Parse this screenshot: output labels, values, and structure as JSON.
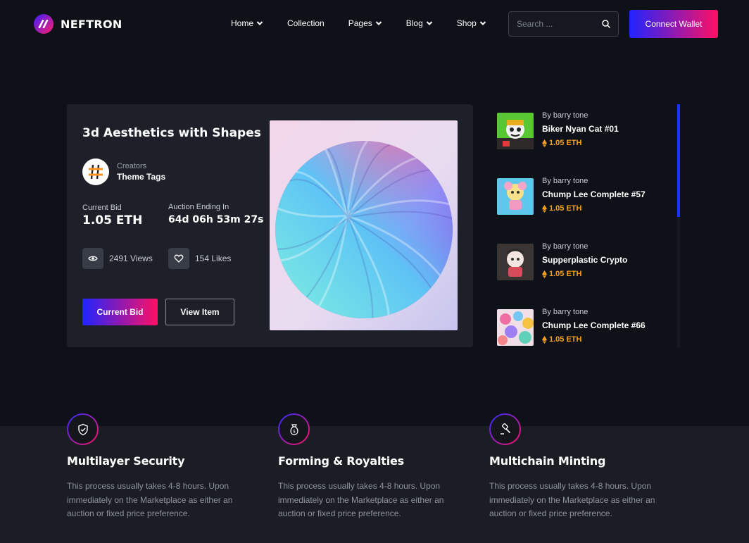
{
  "brand": {
    "name": "NEFTRON"
  },
  "nav": [
    {
      "label": "Home",
      "has_dropdown": true
    },
    {
      "label": "Collection",
      "has_dropdown": false
    },
    {
      "label": "Pages",
      "has_dropdown": true
    },
    {
      "label": "Blog",
      "has_dropdown": true
    },
    {
      "label": "Shop",
      "has_dropdown": true
    }
  ],
  "search": {
    "placeholder": "Search ...",
    "icon": "search-icon"
  },
  "header": {
    "connect_label": "Connect Wallet"
  },
  "featured": {
    "title": "3d Aesthetics with Shapes",
    "creator_label": "Creators",
    "creator_name": "Theme Tags",
    "bid_label": "Current Bid",
    "bid_value": "1.05 ETH",
    "auction_label": "Auction Ending In",
    "auction_value": "64d 06h 53m 27s",
    "views": "2491 Views",
    "likes": "154 Likes",
    "bid_button": "Current Bid",
    "view_button": "View Item"
  },
  "side_items": [
    {
      "by": "By barry tone",
      "name": "Biker Nyan Cat #01",
      "price": "1.05 ETH"
    },
    {
      "by": "By barry tone",
      "name": "Chump Lee Complete #57",
      "price": "1.05 ETH"
    },
    {
      "by": "By barry tone",
      "name": "Supperplastic Crypto",
      "price": "1.05 ETH"
    },
    {
      "by": "By barry tone",
      "name": "Chump Lee Complete #66",
      "price": "1.05 ETH"
    }
  ],
  "features": [
    {
      "icon": "shield-check-icon",
      "title": "Multilayer Security",
      "desc": "This process usually takes 4-8 hours. Upon immediately on the Marketplace as either an auction or fixed price preference."
    },
    {
      "icon": "money-bag-icon",
      "title": "Forming & Royalties",
      "desc": "This process usually takes 4-8 hours. Upon immediately on the Marketplace as either an auction or fixed price preference."
    },
    {
      "icon": "gavel-icon",
      "title": "Multichain Minting",
      "desc": "This process usually takes 4-8 hours. Upon immediately on the Marketplace as either an auction or fixed price preference."
    }
  ],
  "colors": {
    "accent_start": "#1f24ff",
    "accent_end": "#ff1064",
    "price": "#f7a01d",
    "background": "#0e1117",
    "card": "#1d2028"
  }
}
